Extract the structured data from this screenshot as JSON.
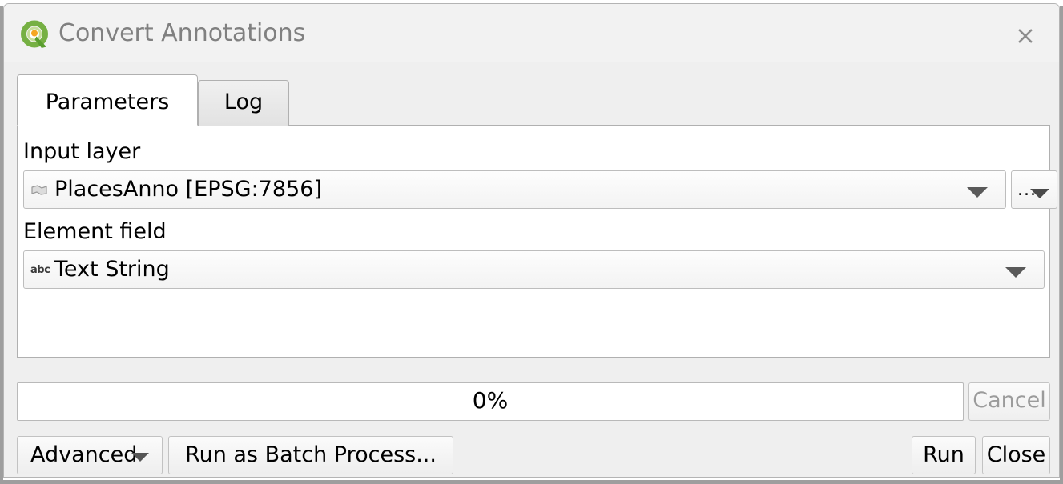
{
  "window": {
    "title": "Convert Annotations",
    "logo_icon": "qgis-logo-icon",
    "close_icon": "close-icon"
  },
  "tabs": [
    {
      "id": "parameters",
      "label": "Parameters",
      "active": true
    },
    {
      "id": "log",
      "label": "Log",
      "active": false
    }
  ],
  "parameters": {
    "input_layer": {
      "label": "Input layer",
      "value": "PlacesAnno [EPSG:7856]",
      "icon": "annotation-layer-icon",
      "dropdown_icon": "chevron-down-icon",
      "browse_button": {
        "label": "...",
        "icon": "ellipsis-dropdown-icon"
      }
    },
    "element_field": {
      "label": "Element field",
      "value": "Text String",
      "icon": "abc-text-field-icon",
      "dropdown_icon": "chevron-down-icon"
    }
  },
  "progress": {
    "percent_label": "0%",
    "value": 0,
    "cancel_label": "Cancel",
    "cancel_enabled": false
  },
  "footer": {
    "advanced_label": "Advanced",
    "advanced_icon": "chevron-down-icon",
    "batch_label": "Run as Batch Process...",
    "run_label": "Run",
    "close_label": "Close"
  },
  "colors": {
    "dialog_background": "#efefef",
    "panel_background": "#ffffff",
    "title_text": "#808080",
    "border": "#b4b4b4",
    "disabled_text": "#9b9b9b",
    "logo_green": "#76b043",
    "logo_orange": "#f5a623"
  }
}
